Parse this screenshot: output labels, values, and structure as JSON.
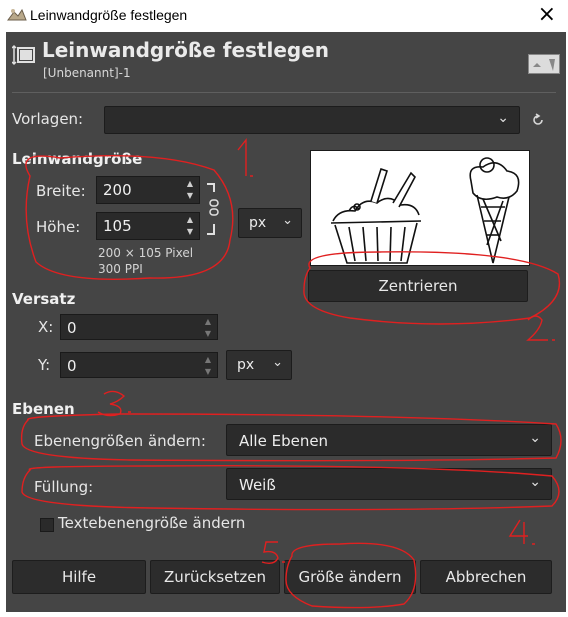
{
  "window": {
    "title": "Leinwandgröße festlegen",
    "close_glyph": "×"
  },
  "header": {
    "title": "Leinwandgröße festlegen",
    "subtitle": "[Unbenannt]-1"
  },
  "presets": {
    "label": "Vorlagen:",
    "value": ""
  },
  "canvas_size": {
    "heading": "Leinwandgröße",
    "width_label": "Breite:",
    "width_value": "200",
    "height_label": "Höhe:",
    "height_value": "105",
    "unit": "px",
    "info_size": "200 × 105 Pixel",
    "info_res": "300 PPI"
  },
  "preview": {
    "center_button": "Zentrieren"
  },
  "offset": {
    "heading": "Versatz",
    "x_label": "X:",
    "x_value": "0",
    "y_label": "Y:",
    "y_value": "0",
    "unit": "px"
  },
  "layers": {
    "heading": "Ebenen",
    "resize_label": "Ebenengrößen ändern:",
    "resize_value": "Alle Ebenen",
    "fill_label": "Füllung:",
    "fill_value": "Weiß",
    "text_layers_label": "Textebenengröße ändern"
  },
  "buttons": {
    "help": "Hilfe",
    "reset": "Zurücksetzen",
    "resize": "Größe ändern",
    "cancel": "Abbrechen"
  },
  "annotations": {
    "n1": "1.",
    "n2": "2.",
    "n3": "3.",
    "n4": "4.",
    "n5": "5.",
    "color": "#e02020"
  }
}
